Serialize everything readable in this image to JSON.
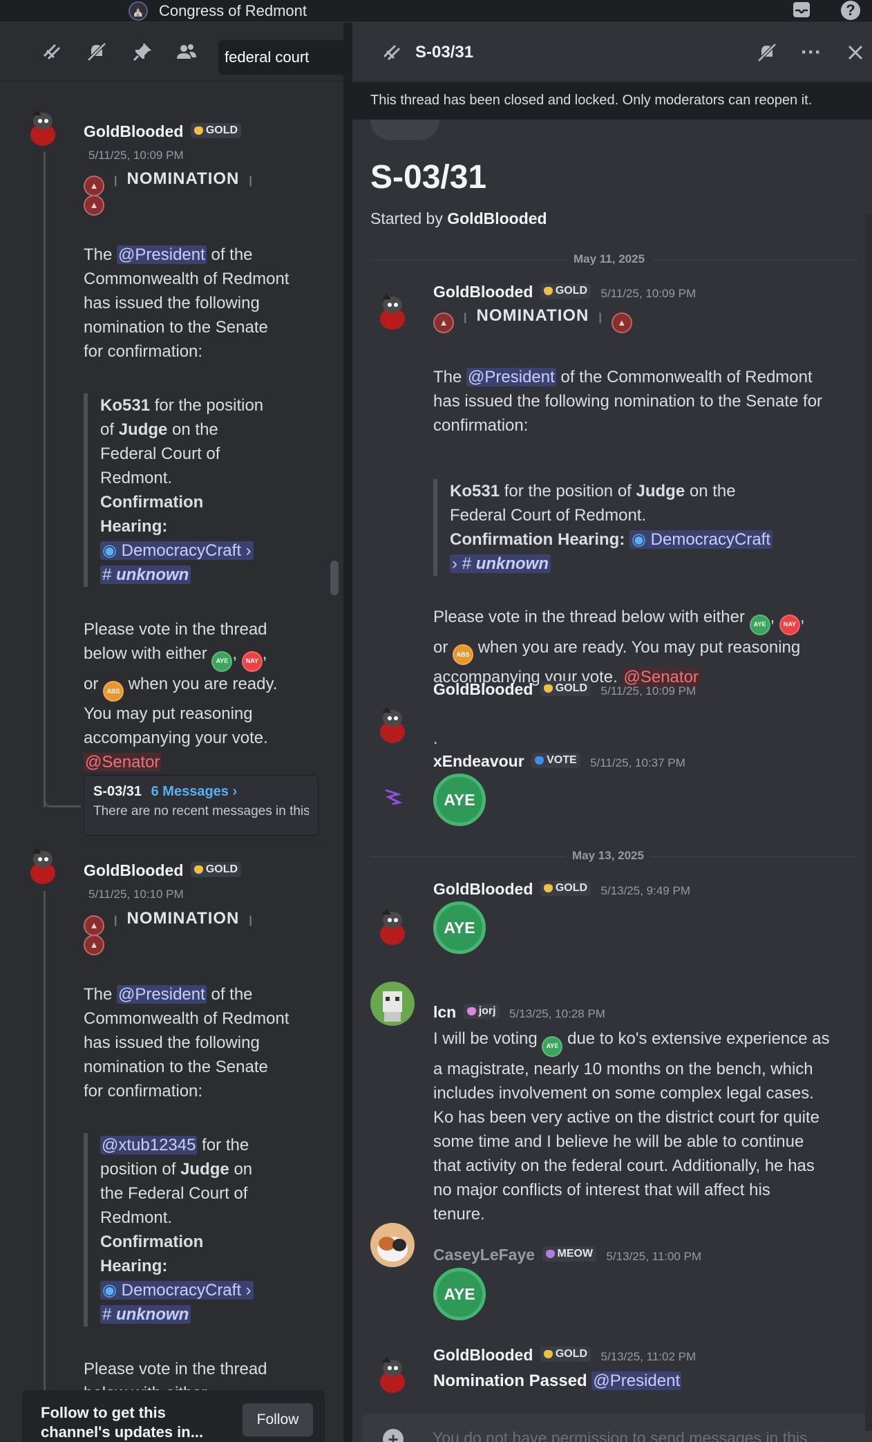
{
  "app": {
    "server_name": "Congress of Redmont"
  },
  "left_panel": {
    "search_value": "federal court",
    "msg1": {
      "author": "GoldBlooded",
      "tag": "GOLD",
      "time": "5/11/25, 10:09 PM",
      "nomination": "NOMINATION",
      "intro_pre": "The",
      "mention_president": "@President",
      "intro_l1_tail": "of the",
      "intro_l2": "Commonwealth of Redmont",
      "intro_l3": "has issued the following",
      "intro_l4": "nomination to the Senate",
      "intro_l5": "for confirmation:",
      "q_l1_bold": "Ko531",
      "q_l1": "for the position",
      "q_l2_pre": "of",
      "q_l2_bold": "Judge",
      "q_l2": "on the",
      "q_l3": "Federal Court of",
      "q_l4": "Redmont.",
      "q_l5": "Confirmation",
      "q_l6": "Hearing:",
      "server_link": "DemocracyCraft",
      "channel": "unknown",
      "v_l1": "Please vote in the thread",
      "v_l2_pre": "below with either",
      "v_l3_pre": "or",
      "v_l3": "when you are ready.",
      "v_l4": "You may put reasoning",
      "v_l5": "accompanying your vote.",
      "mention_senator": "@Senator",
      "thread_name": "S-03/31",
      "thread_count": "6 Messages ›",
      "thread_preview": "There are no recent messages in this thread."
    },
    "msg2": {
      "author": "GoldBlooded",
      "tag": "GOLD",
      "time": "5/11/25, 10:10 PM",
      "nomination": "NOMINATION",
      "intro_pre": "The",
      "mention_president": "@President",
      "intro_l1_tail": "of the",
      "intro_l2": "Commonwealth of Redmont",
      "intro_l3": "has issued the following",
      "intro_l4": "nomination to the Senate",
      "intro_l5": "for confirmation:",
      "q_mention": "@xtub12345",
      "q_l1": "for the",
      "q_l2_pre": "position of",
      "q_l2_bold": "Judge",
      "q_l2": "on",
      "q_l3": "the Federal Court of",
      "q_l4": "Redmont.",
      "q_l5": "Confirmation",
      "q_l6": "Hearing:",
      "server_link": "DemocracyCraft",
      "channel": "unknown",
      "v_l1": "Please vote in the thread",
      "v_l2_pre": "below with either"
    },
    "follow_text_l1": "Follow to get this",
    "follow_text_l2": "channel's updates in...",
    "follow_button": "Follow"
  },
  "vote_labels": {
    "aye": "AYE",
    "nay": "NAY",
    "abs": "ABS"
  },
  "thread": {
    "title": "S-03/31",
    "locked_notice": "This thread has been closed and locked. Only moderators can reopen it.",
    "big_title": "S-03/31",
    "started_by_pre": "Started by",
    "started_by": "GoldBlooded",
    "date1": "May 11, 2025",
    "date2": "May 13, 2025",
    "m1": {
      "author": "GoldBlooded",
      "tag": "GOLD",
      "time": "5/11/25, 10:09 PM",
      "nomination": "NOMINATION",
      "intro_pre": "The",
      "mention_president": "@President",
      "intro_l1_tail": "of the Commonwealth of Redmont",
      "intro_l2": "has issued the following nomination to the Senate for",
      "intro_l3": "confirmation:",
      "q_l1_bold": "Ko531",
      "q_l1": "for the position of",
      "q_l1_bold2": "Judge",
      "q_l1_tail": "on the",
      "q_l2": "Federal Court of Redmont.",
      "q_l3_bold": "Confirmation Hearing:",
      "server_link": "DemocracyCraft",
      "channel": "unknown",
      "v_l1_pre": "Please vote in the thread below with either",
      "v_l2_pre": "or",
      "v_l2": "when you are ready. You may put reasoning",
      "v_l3": "accompanying your vote.",
      "mention_senator": "@Senator"
    },
    "m2": {
      "author": "GoldBlooded",
      "tag": "GOLD",
      "time": "5/11/25, 10:09 PM",
      "text": "."
    },
    "m3": {
      "author": "xEndeavour",
      "tag": "VOTE",
      "time": "5/11/25, 10:37 PM",
      "vote": "AYE"
    },
    "m4": {
      "author": "GoldBlooded",
      "tag": "GOLD",
      "time": "5/13/25, 9:49 PM",
      "vote": "AYE"
    },
    "m5": {
      "author": "lcn",
      "tag": "jorj",
      "time": "5/13/25, 10:28 PM",
      "l1_pre": "I will be voting",
      "l1": "due to ko's extensive experience as",
      "l2": "a magistrate, nearly 10 months on the bench, which",
      "l3": "includes involvement on some complex legal cases.",
      "l4": "Ko has been very active on the district court for quite",
      "l5": "some time and I believe he will be able to continue",
      "l6": "that activity on the federal court. Additionally, he has",
      "l7": "no major conflicts of interest that will affect his",
      "l8": "tenure."
    },
    "m6": {
      "author": "CaseyLeFaye",
      "tag": "MEOW",
      "time": "5/13/25, 11:00 PM",
      "vote": "AYE"
    },
    "m7": {
      "author": "GoldBlooded",
      "tag": "GOLD",
      "time": "5/13/25, 11:02 PM",
      "text_bold": "Nomination Passed",
      "mention_president": "@President"
    },
    "composer_placeholder": "You do not have permission to send messages in this ..."
  },
  "colors": {
    "gold_tag": "#f0c040",
    "vote_tag": "#3b8fe8",
    "jorj_tag": "#d48ad8",
    "meow_tag": "#b27be0",
    "aye": "#3ba55c",
    "nay": "#ed4245",
    "abs": "#e9962b",
    "mention": "#c9cdfb"
  }
}
